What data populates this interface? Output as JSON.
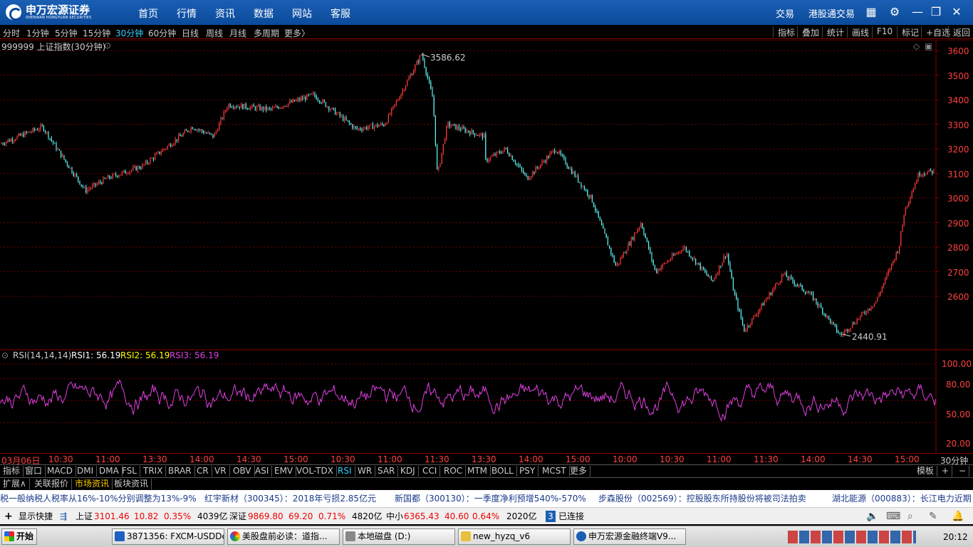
{
  "header": {
    "logo_text": "申万宏源证券",
    "logo_sub": "SHENWAN HONGYUAN SECURITIES",
    "nav": [
      "首页",
      "行情",
      "资讯",
      "数据",
      "网站",
      "客服"
    ],
    "right": [
      "交易",
      "港股通交易"
    ],
    "icons": [
      "grid-icon",
      "gear-icon",
      "minimize-icon",
      "restore-icon",
      "close-icon"
    ]
  },
  "periods": [
    "分时",
    "1分钟",
    "5分钟",
    "15分钟",
    "30分钟",
    "60分钟",
    "日线",
    "周线",
    "月线",
    "多周期",
    "更多〉"
  ],
  "active_period": "30分钟",
  "tools": [
    "指标",
    "叠加",
    "统计",
    "画线",
    "F10",
    "标记",
    "+自选",
    "返回"
  ],
  "chart_title": "999999 上证指数(30分钟)",
  "price_axis": [
    "3600",
    "3500",
    "3400",
    "3300",
    "3200",
    "3100",
    "3000",
    "2900",
    "2800",
    "2700",
    "2600"
  ],
  "high_label": "3586.62",
  "low_label": "2440.91",
  "rsi_label": {
    "name": "RSI(14,14,14)",
    "r1": "RSI1: 56.19",
    "r2": "RSI2: 56.19",
    "r3": "RSI3: 56.19"
  },
  "rsi_axis": [
    "100.00",
    "80.00",
    "50.00",
    "20.00"
  ],
  "time_axis": [
    "03月06日",
    "10:30",
    "11:00",
    "13:30",
    "14:00",
    "14:30",
    "15:00",
    "10:30",
    "11:00",
    "11:30",
    "13:30",
    "14:00",
    "15:00",
    "10:00",
    "10:30",
    "11:00",
    "11:30",
    "14:00",
    "14:30",
    "15:00"
  ],
  "period_corner": "30分钟",
  "indicator_tabs": [
    "指标",
    "窗口",
    "MACD",
    "DMI",
    "DMA",
    "FSL",
    "TRIX",
    "BRAR",
    "CR",
    "VR",
    "OBV",
    "ASI",
    "EMV",
    "VOL-TDX",
    "RSI",
    "WR",
    "SAR",
    "KDJ",
    "CCI",
    "ROC",
    "MTM",
    "BOLL",
    "PSY",
    "MCST",
    "更多"
  ],
  "active_indicator": "RSI",
  "indicator_right": [
    "模板",
    "+",
    "−"
  ],
  "ext_tabs": [
    "扩展∧",
    "关联报价",
    "市场资讯",
    "板块资讯"
  ],
  "ticker": [
    "税一般纳税人税率从16%-10%分别调整为13%-9%",
    "红宇新材（300345）：2018年亏损2.85亿元",
    "新国都（300130）：一季度净利预增540%-570%",
    "步森股份（002569）：控股股东所持股份将被司法拍卖",
    "湖北能源（000883）：长江电力近期"
  ],
  "status": {
    "quick": "显示快捷",
    "sh_name": "上证",
    "sh_val": "3101.46",
    "sh_chg": "10.82",
    "sh_pct": "0.35%",
    "sh_amt": "4039亿",
    "sz_name": "深证",
    "sz_val": "9869.80",
    "sz_chg": "69.20",
    "sz_pct": "0.71%",
    "sz_amt": "4820亿",
    "zx_name": "中小",
    "zx_val": "6365.43",
    "zx_chg": "40.60",
    "zx_pct": "0.64%",
    "zx_amt": "2020亿",
    "conn_num": "3",
    "conn": "已连接"
  },
  "taskbar": {
    "start": "开始",
    "tasks": [
      "3871356: FXCM-USDDe...",
      "美股盘前必读：道指...",
      "本地磁盘 (D:)",
      "new_hyzq_v6",
      "申万宏源金融终端V9..."
    ],
    "clock": "20:12"
  },
  "colors": {
    "up": "#ff3b3b",
    "down": "#5ff5f5",
    "rsi": "#e040e0",
    "grid": "#8b0000"
  }
}
